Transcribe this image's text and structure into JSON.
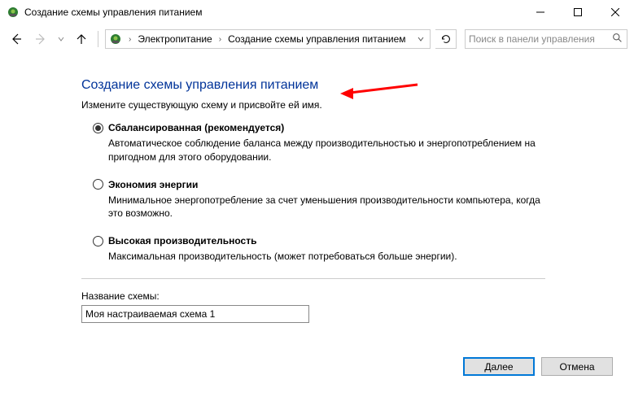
{
  "window": {
    "title": "Создание схемы управления питанием"
  },
  "breadcrumb": {
    "item1": "Электропитание",
    "item2": "Создание схемы управления питанием"
  },
  "search": {
    "placeholder": "Поиск в панели управления"
  },
  "page": {
    "title": "Создание схемы управления питанием",
    "subtitle": "Измените существующую схему и присвойте ей имя."
  },
  "plans": {
    "balanced": {
      "label": "Сбалансированная (рекомендуется)",
      "desc": "Автоматическое соблюдение баланса между производительностью и энергопотреблением на пригодном для этого оборудовании."
    },
    "saver": {
      "label": "Экономия энергии",
      "desc": "Минимальное энергопотребление за счет уменьшения производительности компьютера, когда это возможно."
    },
    "high": {
      "label": "Высокая производительность",
      "desc": "Максимальная производительность (может потребоваться больше энергии)."
    }
  },
  "name_field": {
    "label": "Название схемы:",
    "value": "Моя настраиваемая схема 1"
  },
  "buttons": {
    "next": "Далее",
    "cancel": "Отмена"
  }
}
